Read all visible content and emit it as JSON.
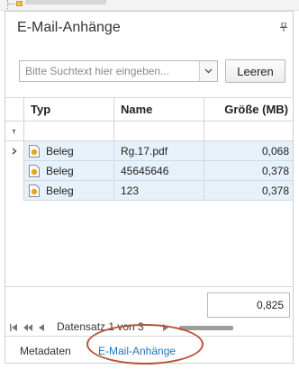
{
  "panel": {
    "title": "E-Mail-Anhänge"
  },
  "search": {
    "placeholder": "Bitte Suchtext hier eingeben...",
    "value": "",
    "clear_label": "Leeren"
  },
  "grid": {
    "columns": [
      "Typ",
      "Name",
      "Größe (MB)"
    ],
    "rows": [
      {
        "typ": "Beleg",
        "name": "Rg.17.pdf",
        "size": "0,068"
      },
      {
        "typ": "Beleg",
        "name": "45645646",
        "size": "0,378"
      },
      {
        "typ": "Beleg",
        "name": "123",
        "size": "0,378"
      }
    ],
    "total": "0,825"
  },
  "navigator": {
    "record_text": "Datensatz 1 von 3"
  },
  "tabs": [
    {
      "label": "Metadaten",
      "active": false
    },
    {
      "label": "E-Mail-Anhänge",
      "active": true
    }
  ],
  "colors": {
    "selection_bg": "#e7f1f9",
    "active_tab": "#1e73be",
    "highlight_oval": "#b8523a",
    "doc_icon": "#e8a323"
  },
  "icons": {
    "pin": "pin-icon",
    "dropdown": "chevron-down-icon",
    "filter": "filter-icon",
    "row_indicator": "row-pointer-icon",
    "document": "document-icon"
  }
}
